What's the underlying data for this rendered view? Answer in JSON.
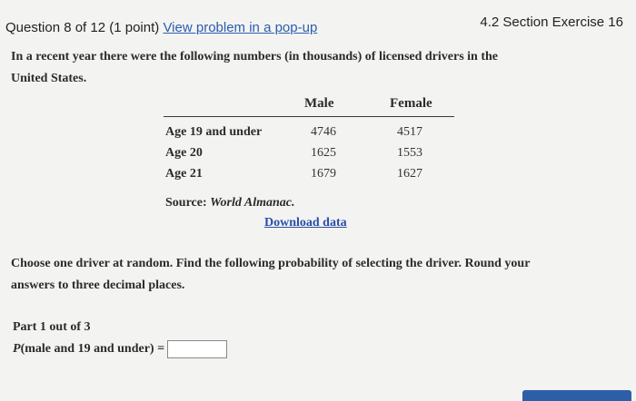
{
  "header": {
    "question_label": "Question 8 of 12 (1 point)",
    "popup_link": "View problem in a pop-up",
    "section_label": "4.2 Section Exercise 16"
  },
  "problem": {
    "intro_line1": "In a recent year there were the following numbers (in thousands) of licensed drivers in the",
    "intro_line2": "United States.",
    "table": {
      "columns": [
        "Male",
        "Female"
      ],
      "rows": [
        {
          "label": "Age 19 and under",
          "male": "4746",
          "female": "4517"
        },
        {
          "label": "Age 20",
          "male": "1625",
          "female": "1553"
        },
        {
          "label": "Age 21",
          "male": "1679",
          "female": "1627"
        }
      ]
    },
    "source_prefix": "Source:",
    "source_name": "World Almanac.",
    "download_link": "Download data",
    "instructions_line1": "Choose one driver at random. Find the following probability of selecting the driver. Round your",
    "instructions_line2": "answers to three decimal places."
  },
  "part": {
    "label": "Part 1 out of 3",
    "p_symbol": "P",
    "expression": "(male and 19 and under) =",
    "answer_value": ""
  }
}
